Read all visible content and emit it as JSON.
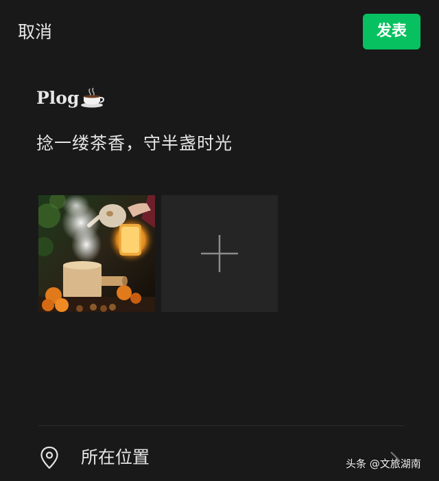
{
  "header": {
    "cancel_label": "取消",
    "publish_label": "发表"
  },
  "post": {
    "title": "Plog",
    "title_icon": "coffee-cup-icon",
    "body": "捻一缕茶香，守半盏时光"
  },
  "media": {
    "attached_image": "tea-photo",
    "add_icon": "plus-icon"
  },
  "location": {
    "icon": "location-pin-icon",
    "label": "所在位置",
    "chevron": "chevron-right-icon"
  },
  "watermark": {
    "text": "头条 @文旅湖南"
  },
  "colors": {
    "background": "#191919",
    "accent": "#07c160",
    "tile": "#252525"
  }
}
